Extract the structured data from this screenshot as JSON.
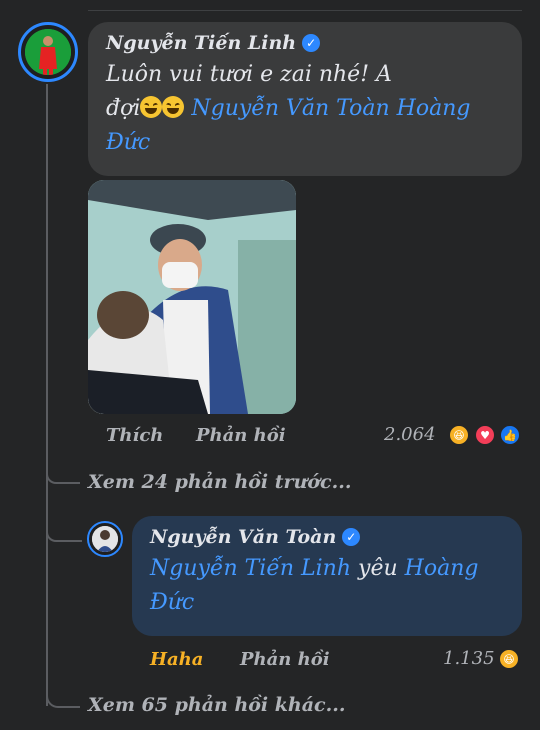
{
  "comment": {
    "author": "Nguyễn Tiến Linh",
    "text_line1": "Luôn vui tươi e zai nhé! A",
    "text_prefix": "đợi",
    "mentions": "Nguyễn Văn Toàn Hoàng",
    "mentions_line2": "Đức",
    "like_label": "Thích",
    "reply_label": "Phản hồi",
    "reaction_count": "2.064"
  },
  "view_previous": "Xem 24 phản hồi trước...",
  "reply": {
    "author": "Nguyễn Văn Toàn",
    "mention1": "Nguyễn Tiến Linh",
    "middle": "yêu",
    "mention2": "Hoàng",
    "mention2_line2": "Đức",
    "reaction_label": "Haha",
    "reply_label": "Phản hồi",
    "reaction_count": "1.135"
  },
  "view_more": "Xem 65 phản hồi khác...",
  "colors": {
    "accent": "#2d88ff",
    "haha": "#f7b125",
    "love": "#f33e58",
    "like": "#1877f2"
  },
  "icons": [
    "verified-badge-icon",
    "haha-reaction-icon",
    "love-reaction-icon",
    "like-reaction-icon"
  ]
}
